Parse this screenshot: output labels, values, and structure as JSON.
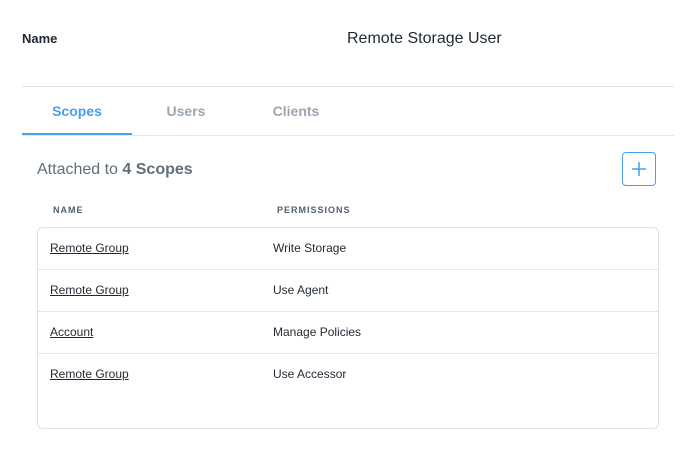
{
  "header": {
    "name_label": "Name",
    "name_value": "Remote Storage User"
  },
  "tabs": [
    {
      "label": "Scopes",
      "active": true
    },
    {
      "label": "Users",
      "active": false
    },
    {
      "label": "Clients",
      "active": false
    }
  ],
  "scopes": {
    "attached_prefix": "Attached to",
    "attached_count": "4 Scopes",
    "add_icon": "plus-icon",
    "columns": {
      "name": "NAME",
      "permissions": "PERMISSIONS"
    },
    "rows": [
      {
        "name": "Remote Group",
        "permission": "Write Storage"
      },
      {
        "name": "Remote Group",
        "permission": "Use Agent"
      },
      {
        "name": "Account",
        "permission": "Manage Policies"
      },
      {
        "name": "Remote Group",
        "permission": "Use Accessor"
      }
    ]
  },
  "colors": {
    "accent": "#4a9fe8",
    "text": "#1f2933",
    "muted": "#9aa5b1"
  }
}
